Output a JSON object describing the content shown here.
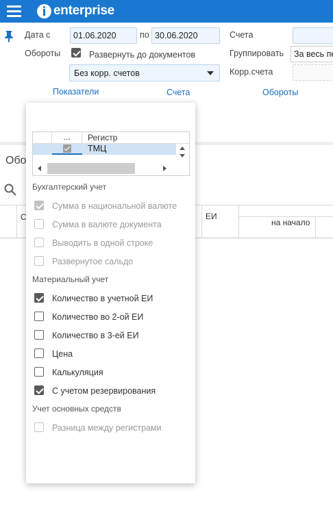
{
  "app": {
    "logo_text": "enterprise"
  },
  "filters": {
    "date_from_label": "Дата с",
    "date_from_value": "01.06.2020",
    "date_to_label": "по",
    "date_to_value": "30.06.2020",
    "accounts_label": "Счета",
    "turnovers_label": "Обороты",
    "expand_to_docs_label": "Развернуть до документов",
    "expand_to_docs_checked": true,
    "group_label": "Группировать",
    "group_value": "За весь пе",
    "corr_select_value": "Без корр. счетов",
    "corr_accounts_label": "Корр.счета"
  },
  "tabs": [
    "Показатели",
    "Счета",
    "Обороты"
  ],
  "background": {
    "title": "Обо",
    "col_fragment": "С",
    "col_ei": "ЕИ",
    "col_start": "на начало"
  },
  "popup": {
    "grid": {
      "header_dots": "...",
      "header_label": "Регистр",
      "row_label": "ТМЦ",
      "row_checked": true
    },
    "sections": [
      {
        "title": "Бухгалтерский учет",
        "options": [
          {
            "label": "Сумма в национальной валюте",
            "checked": true,
            "disabled": true
          },
          {
            "label": "Сумма в валюте документа",
            "checked": false,
            "disabled": true
          },
          {
            "label": "Выводить в одной строке",
            "checked": false,
            "disabled": true
          },
          {
            "label": "Развернутое сальдо",
            "checked": false,
            "disabled": true
          }
        ]
      },
      {
        "title": "Материальный учет",
        "options": [
          {
            "label": "Количество в учетной ЕИ",
            "checked": true,
            "disabled": false
          },
          {
            "label": "Количество во 2-ой ЕИ",
            "checked": false,
            "disabled": false
          },
          {
            "label": "Количество в 3-ей ЕИ",
            "checked": false,
            "disabled": false
          },
          {
            "label": "Цена",
            "checked": false,
            "disabled": false
          },
          {
            "label": "Калькуляция",
            "checked": false,
            "disabled": false
          },
          {
            "label": "С учетом резервирования",
            "checked": true,
            "disabled": false
          }
        ]
      },
      {
        "title": "Учет основных средств",
        "options": [
          {
            "label": "Разница между регистрами",
            "checked": false,
            "disabled": true
          }
        ]
      }
    ]
  },
  "colors": {
    "topbar": "#1a78d0",
    "accent": "#1a6fc2",
    "field_bg": "#eef5fd",
    "selected_row": "#cfe2f6"
  }
}
